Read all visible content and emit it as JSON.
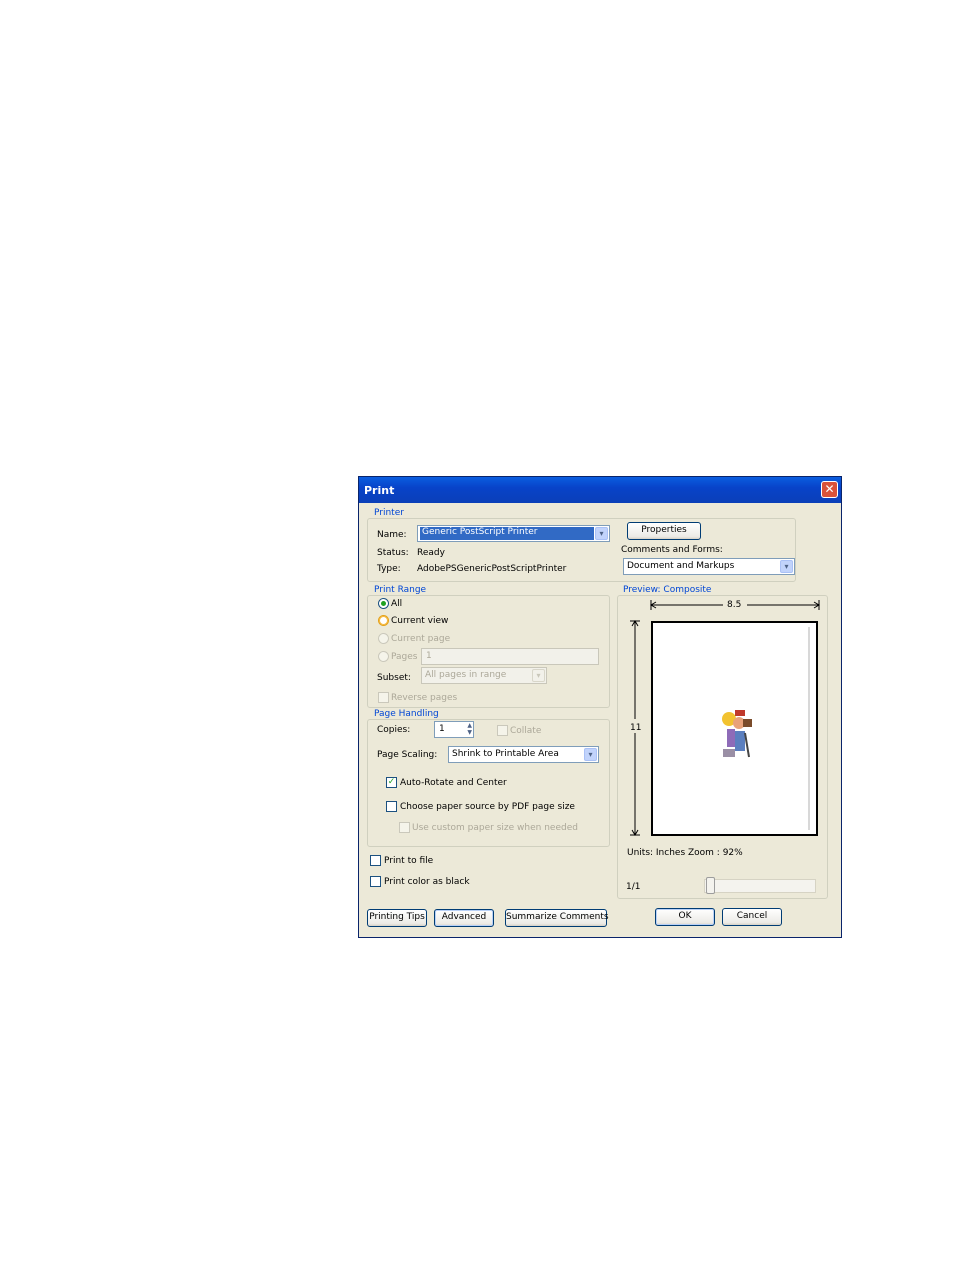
{
  "dialog": {
    "title": "Print",
    "close_glyph": "✕"
  },
  "printer": {
    "group_label": "Printer",
    "name_label": "Name:",
    "name_value": "Generic PostScript Printer",
    "status_label": "Status:",
    "status_value": "Ready",
    "type_label": "Type:",
    "type_value": "AdobePSGenericPostScriptPrinter",
    "properties_button": "Properties",
    "comments_label": "Comments and Forms:",
    "comments_value": "Document and Markups"
  },
  "print_range": {
    "group_label": "Print Range",
    "all": "All",
    "current_view": "Current view",
    "current_page": "Current page",
    "pages": "Pages",
    "pages_value": "1",
    "subset_label": "Subset:",
    "subset_value": "All pages in range",
    "reverse_pages": "Reverse pages"
  },
  "page_handling": {
    "group_label": "Page Handling",
    "copies_label": "Copies:",
    "copies_value": "1",
    "collate": "Collate",
    "scaling_label": "Page Scaling:",
    "scaling_value": "Shrink to Printable Area",
    "auto_rotate": "Auto-Rotate and Center",
    "choose_paper": "Choose paper source by PDF page size",
    "custom_paper": "Use custom paper size when needed"
  },
  "options": {
    "print_to_file": "Print to file",
    "print_color_black": "Print color as black"
  },
  "preview": {
    "group_label": "Preview: Composite",
    "width_label": "8.5",
    "height_label": "11",
    "units_zoom": "Units: Inches Zoom :  92%",
    "page_indicator": "1/1"
  },
  "buttons": {
    "printing_tips": "Printing Tips",
    "advanced": "Advanced",
    "summarize": "Summarize Comments",
    "ok": "OK",
    "cancel": "Cancel"
  },
  "icons": {
    "dropdown": "▾",
    "check": "✓",
    "spin_up": "▲",
    "spin_down": "▼"
  },
  "colors": {
    "titlebar": "#0a5ee0",
    "group_label": "#0046d5",
    "dialog_bg": "#ece9d8"
  }
}
